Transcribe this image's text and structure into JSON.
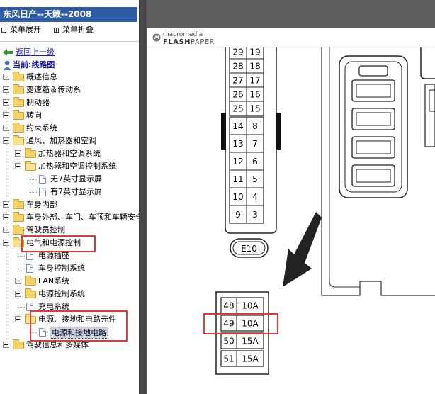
{
  "window": {
    "title": "东风日产--天籁--2008"
  },
  "menu": {
    "expand_label": "菜单展开",
    "collapse_label": "菜单折叠"
  },
  "nav": {
    "back_label": "返回上一级",
    "current_label": "当前:线路图"
  },
  "tree": [
    {
      "label": "概述信息"
    },
    {
      "label": "变速箱＆传动系"
    },
    {
      "label": "制动器"
    },
    {
      "label": "转向"
    },
    {
      "label": "约束系统"
    },
    {
      "label": "通风、加热器和空调"
    },
    {
      "label": "加热器和空调系统"
    },
    {
      "label": "加热器和空调控制系统"
    },
    {
      "label": "无7英寸显示屏"
    },
    {
      "label": "有7英寸显示屏"
    },
    {
      "label": "车身内部"
    },
    {
      "label": "车身外部、车门、车顶和车辆安全"
    },
    {
      "label": "驾驶员控制"
    },
    {
      "label": "电气和电源控制"
    },
    {
      "label": "电源插座"
    },
    {
      "label": "车身控制系统"
    },
    {
      "label": "LAN系统"
    },
    {
      "label": "电源控制系统"
    },
    {
      "label": "充电系统"
    },
    {
      "label": "电源、接地和电路元件"
    },
    {
      "label": "电源和接地电路"
    },
    {
      "label": "驾驶信息和多媒体"
    }
  ],
  "viewer": {
    "logo_top": "macromedia",
    "logo_bottom_a": "FLASH",
    "logo_bottom_b": "PAPER"
  },
  "diagram": {
    "connector_label": "E10",
    "top_pairs": [
      [
        "29",
        "19"
      ],
      [
        "28",
        "18"
      ],
      [
        "27",
        "17"
      ],
      [
        "26",
        "16"
      ],
      [
        "25",
        "15"
      ]
    ],
    "lower_pairs": [
      [
        "14",
        "8"
      ],
      [
        "13",
        "7"
      ],
      [
        "12",
        "6"
      ],
      [
        "11",
        "5"
      ],
      [
        "10",
        "4"
      ],
      [
        "9",
        "3"
      ]
    ],
    "fuses": [
      {
        "num": "48",
        "amp": "10A"
      },
      {
        "num": "49",
        "amp": "10A"
      },
      {
        "num": "50",
        "amp": "15A"
      },
      {
        "num": "51",
        "amp": "15A"
      }
    ]
  },
  "colors": {
    "title_bar": "#2d5ba4",
    "highlight_box": "#e03a3a",
    "link": "#1a1ab0"
  }
}
